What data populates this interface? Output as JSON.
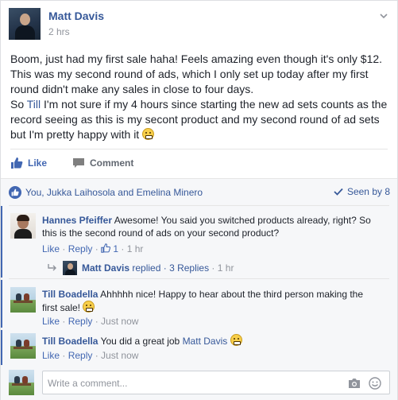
{
  "post": {
    "author": "Matt Davis",
    "time": "2 hrs",
    "text_para1": "Boom, just had my first sale haha! Feels amazing even though it's only $12. This was my second round of ads, which I only set up today after my first round didn't make any sales in close to four days.",
    "text_p2_pre": "So ",
    "text_p2_mention": "Till",
    "text_p2_post": " I'm not sure if my 4 hours since starting the new ad sets counts as the record seeing as this is my secont product and my second round of ad sets but I'm pretty happy with it "
  },
  "actions": {
    "like_label": "Like",
    "comment_label": "Comment"
  },
  "reactions": {
    "who": "You, Jukka Laihosola and Emelina Minero",
    "seen": "Seen by 8"
  },
  "comments": [
    {
      "name": "Hannes Pfeiffer",
      "text": " Awesome! You said you switched products already, right? So this is the second round of ads on your second product?",
      "like": "Like",
      "reply": "Reply",
      "likes_count": "1",
      "time": "1 hr",
      "reply_summary": {
        "name": "Matt Davis",
        "replied": " replied · ",
        "count": "3 Replies",
        "time": " · 1 hr"
      }
    },
    {
      "name": "Till Boadella",
      "text": " Ahhhhh nice! Happy to hear about the third person making the first sale! ",
      "like": "Like",
      "reply": "Reply",
      "time": "Just now"
    },
    {
      "name": "Till Boadella",
      "text_pre": " You did a great job ",
      "mention": "Matt Davis",
      "like": "Like",
      "reply": "Reply",
      "time": "Just now"
    }
  ],
  "write_comment": {
    "placeholder": "Write a comment..."
  },
  "colors": {
    "link": "#365899",
    "accent": "#4267b2",
    "muted": "#90949c",
    "background": "#f6f7f9"
  }
}
